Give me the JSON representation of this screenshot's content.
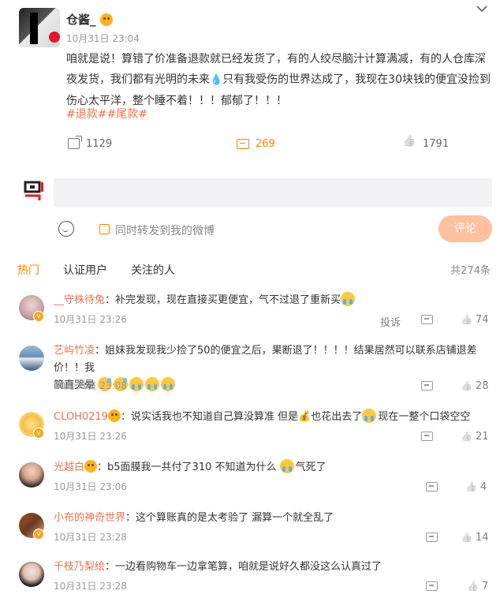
{
  "post": {
    "username": "仓酱_",
    "time": "10月31日 23:04",
    "text_part1": "咱就是说！算错了价准备退款就已经发货了，有的人绞尽脑汁计算满减，有的人仓库深夜发货，我们都有光明的未来",
    "text_part2": "只有我受伤的世界达成了，我现在30块钱的便宜没捡到伤心太平洋，整个睡不着！！！郁郁了！！！",
    "tags": "#退款##尾款#",
    "share_count": "1129",
    "comment_count": "269",
    "like_count": "1791"
  },
  "compose": {
    "placeholder": "",
    "forward_label": "同时转发到我的微博",
    "submit_label": "评论"
  },
  "tabs": [
    {
      "label": "热门",
      "active": true
    },
    {
      "label": "认证用户",
      "active": false
    },
    {
      "label": "关注的人",
      "active": false
    }
  ],
  "total": "共274条",
  "report_label": "投诉",
  "comments": [
    {
      "name": "__守株待兔",
      "text": "补完发现，现在直接买更便宜，气不过退了重新买",
      "time": "10月31日 23:26",
      "likes": "74",
      "show_report": true
    },
    {
      "name": "艺屿竹凌",
      "text": "姐妹我发现我少捡了50的便宜之后，果断退了！！！！结果居然可以联系店铺退差价！！我",
      "text2": "简直哭晕",
      "time": "10月31日 23:08",
      "likes": "28"
    },
    {
      "name": "CLOH0219",
      "text_a": "说实话我也不知道自己算没算准 但是",
      "text_b": "也花出去了",
      "text_c": "现在一整个口袋空空",
      "time": "10月31日 23:26",
      "likes": "21"
    },
    {
      "name": "光越白",
      "text": "b5面膜我一共付了310 不知道为什么",
      "text_tail": "气死了",
      "time": "10月31日 23:06",
      "likes": "4"
    },
    {
      "name": "小布的神奇世界",
      "text": "这个算账真的是太考验了 漏算一个就全乱了",
      "time": "10月31日 23:28",
      "likes": "14"
    },
    {
      "name": "千枝乃梨绘",
      "text": "一边看购物车一边拿笔算，咱就是说好久都没这么认真过了",
      "time": "10月31日 23:28",
      "likes": "7"
    }
  ],
  "colors": {
    "accent": "#ff8200",
    "name": "#eb7350",
    "submit_bg": "#ffc09f"
  }
}
